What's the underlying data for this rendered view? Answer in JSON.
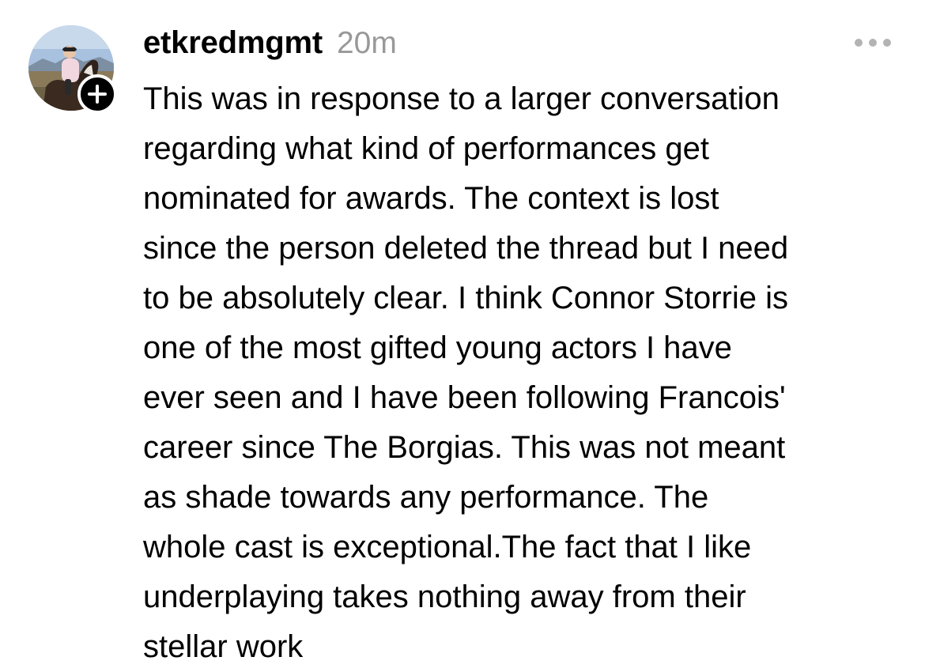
{
  "post": {
    "author": {
      "username": "etkredmgmt",
      "avatar_icon": "profile-photo-rider-on-horse",
      "follow_icon": "plus-icon"
    },
    "timestamp": "20m",
    "more_icon": "ellipsis-icon",
    "text": "This was in response to a larger conversation\nregarding what kind of performances get\nnominated for awards. The context is lost\nsince the person deleted the thread but I need\nto be absolutely clear. I think Connor Storrie is\none of the most gifted young actors I have\never seen and I have been following Francois'\ncareer since The Borgias. This was not meant\nas shade towards any performance. The\nwhole cast is exceptional.The fact that I like\nunderplaying takes nothing away from their\nstellar work"
  },
  "colors": {
    "text": "#000000",
    "muted": "#999999",
    "more_icon": "#b3b3b3",
    "background": "#ffffff"
  }
}
